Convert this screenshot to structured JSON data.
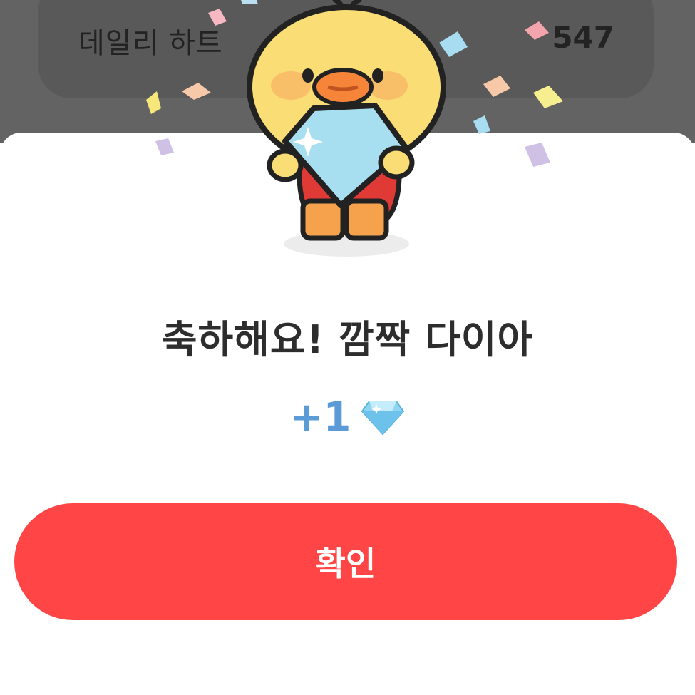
{
  "background_card": {
    "label": "데일리 하트",
    "count": "547"
  },
  "dialog": {
    "title": "축하해요! 깜짝 다이아",
    "reward_amount": "+1",
    "reward_icon": "diamond-icon",
    "confirm_label": "확인"
  },
  "colors": {
    "confirm_button": "#ff4545",
    "reward_text": "#5b9bd6",
    "overlay": "#636363"
  },
  "illustration": "duck-holding-diamond-icon"
}
